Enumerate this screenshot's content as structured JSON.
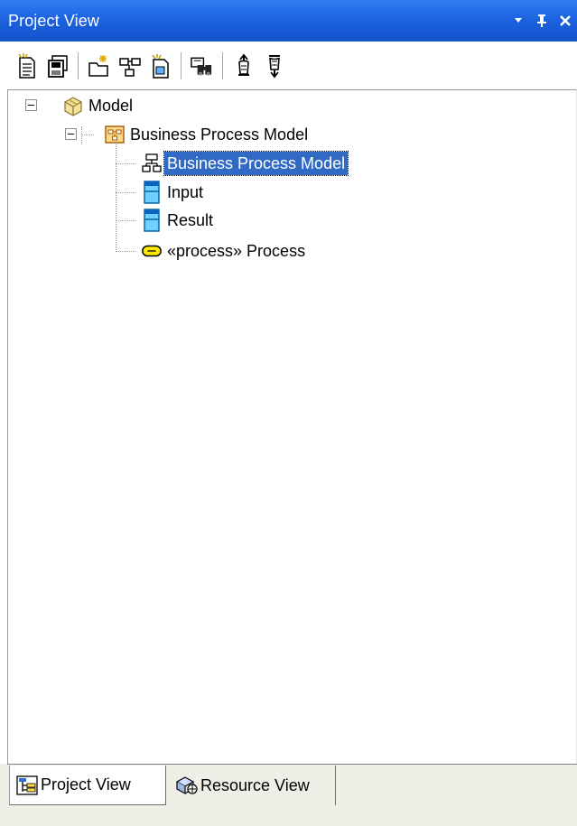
{
  "window": {
    "title": "Project View",
    "dropdown_icon": "dropdown-arrow-icon",
    "pin_icon": "pin-icon",
    "close_icon": "close-icon"
  },
  "toolbar": {
    "buttons": [
      {
        "icon": "new-document-icon"
      },
      {
        "icon": "save-icon"
      },
      {
        "icon": "new-folder-icon"
      },
      {
        "icon": "new-diagram-icon"
      },
      {
        "icon": "new-element-icon"
      },
      {
        "icon": "search-binoculars-icon"
      },
      {
        "icon": "move-up-icon"
      },
      {
        "icon": "move-down-icon"
      }
    ]
  },
  "tree": {
    "root": {
      "label": "Model",
      "icon": "package-icon",
      "expanded": true
    },
    "package": {
      "label": "Business Process Model",
      "icon": "business-package-icon",
      "expanded": true
    },
    "children": [
      {
        "label": "Business Process Model",
        "icon": "diagram-icon",
        "selected": true
      },
      {
        "label": "Input",
        "icon": "object-icon"
      },
      {
        "label": "Result",
        "icon": "object-icon"
      },
      {
        "label": "«process» Process",
        "icon": "process-icon"
      }
    ]
  },
  "tabs": [
    {
      "label": "Project View",
      "icon": "project-tree-icon",
      "active": true
    },
    {
      "label": "Resource View",
      "icon": "resources-icon",
      "active": false
    }
  ],
  "colors": {
    "titlebar": "#1a5fdc",
    "selection": "#316ac5",
    "tabstrip": "#f0efe7"
  }
}
